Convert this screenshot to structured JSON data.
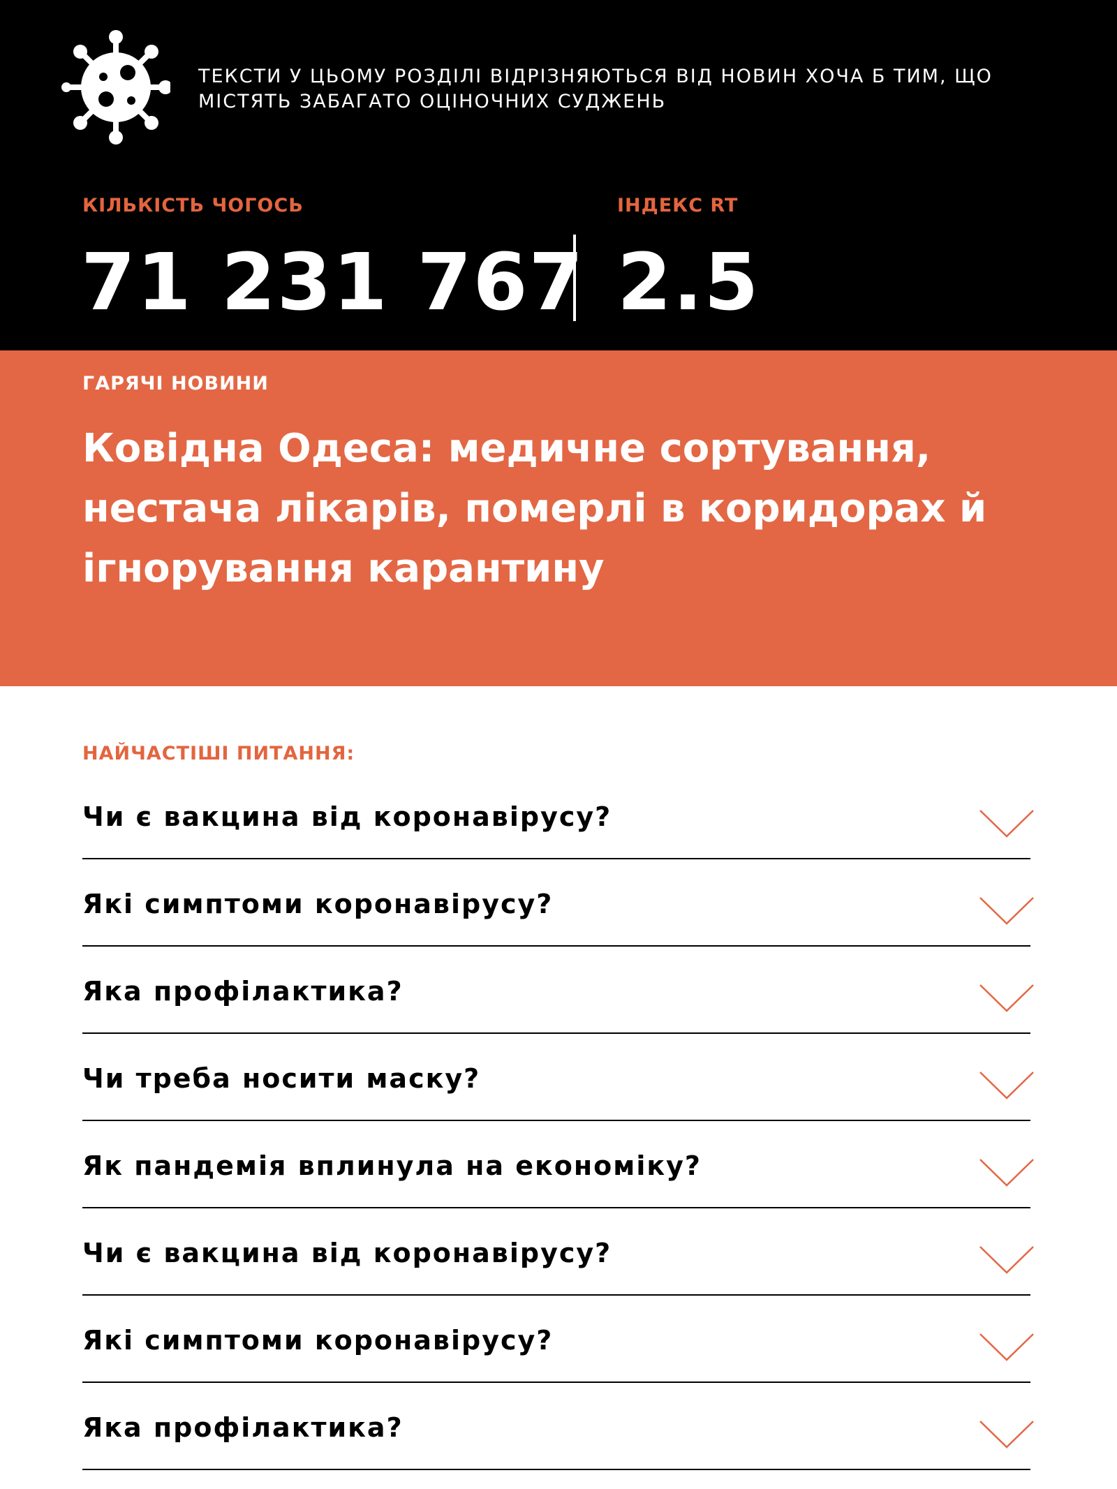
{
  "header": {
    "logo_icon": "virus-icon",
    "disclaimer": "Тексти у цьому розділі відрізняються від новин хоча б тим, що містять забагато оціночних суджень"
  },
  "stats": {
    "count_label": "Кількість чогось",
    "count_value": "71 231 767",
    "rt_label": "Індекс RT",
    "rt_value": "2.5"
  },
  "hot_news": {
    "kicker": "Гарячі новини",
    "headline": "Ковідна Одеса: медичне сортування, нестача лікарів, померлі в коридорах й ігнорування карантину"
  },
  "faq": {
    "heading": "Найчастіші питання:",
    "items": [
      {
        "question": "Чи є вакцина від коронавірусу?"
      },
      {
        "question": "Які симптоми коронавірусу?"
      },
      {
        "question": "Яка профілактика?"
      },
      {
        "question": "Чи треба носити маску?"
      },
      {
        "question": "Як пандемія вплинула на економіку?"
      },
      {
        "question": "Чи є вакцина від коронавірусу?"
      },
      {
        "question": "Які симптоми коронавірусу?"
      },
      {
        "question": "Яка профілактика?"
      }
    ],
    "expand_icon": "chevron-down-icon"
  },
  "colors": {
    "accent": "#e36744",
    "header_bg": "#000000",
    "text": "#000000"
  }
}
